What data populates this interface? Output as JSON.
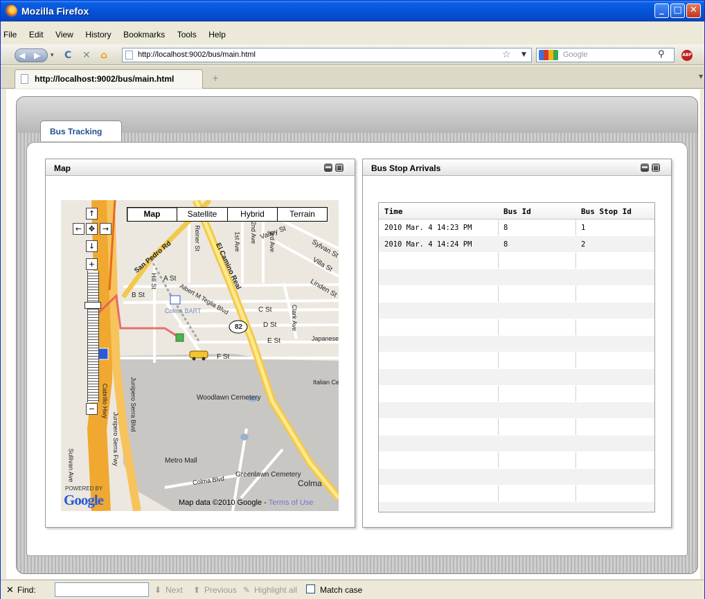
{
  "window": {
    "title": "Mozilla Firefox"
  },
  "menu": [
    "File",
    "Edit",
    "View",
    "History",
    "Bookmarks",
    "Tools",
    "Help"
  ],
  "nav": {
    "url": "http://localhost:9002/bus/main.html",
    "search_placeholder": "Google"
  },
  "browser_tab": {
    "label": "http://localhost:9002/bus/main.html"
  },
  "app": {
    "tab_label": "Bus Tracking",
    "map_panel_title": "Map",
    "arrivals_panel_title": "Bus Stop Arrivals"
  },
  "map": {
    "types": [
      "Map",
      "Satellite",
      "Hybrid",
      "Terrain"
    ],
    "active_type": "Map",
    "attribution": "Map data ©2010  Google - ",
    "terms_link": "Terms of Use",
    "powered_by": "POWERED BY",
    "logo": "Google",
    "labels": [
      {
        "text": "San Pedro Rd"
      },
      {
        "text": "El Camino Real"
      },
      {
        "text": "Reiner St"
      },
      {
        "text": "2nd Ave"
      },
      {
        "text": "1st Ave"
      },
      {
        "text": "3rd Ave"
      },
      {
        "text": "Valley St"
      },
      {
        "text": "Sylvan St"
      },
      {
        "text": "Villa St"
      },
      {
        "text": "Linden St"
      },
      {
        "text": "A St"
      },
      {
        "text": "B St"
      },
      {
        "text": "C St"
      },
      {
        "text": "D St"
      },
      {
        "text": "E St"
      },
      {
        "text": "F St"
      },
      {
        "text": "Hill St"
      },
      {
        "text": "Albert M Teglia Blvd"
      },
      {
        "text": "Colma BART"
      },
      {
        "text": "Clark Ave"
      },
      {
        "text": "Woodlawn Cemetery"
      },
      {
        "text": "Metro Mall"
      },
      {
        "text": "Greenlawn Cemetery"
      },
      {
        "text": "Colma"
      },
      {
        "text": "Colma Blvd"
      },
      {
        "text": "Junipero Serra Blvd"
      },
      {
        "text": "Cabrillo Hwy"
      },
      {
        "text": "Junipero Serra Fwy"
      },
      {
        "text": "Japanese Cemetery"
      },
      {
        "text": "Italian Cemetery"
      },
      {
        "text": "Sullivan Ave"
      },
      {
        "text": "82"
      }
    ]
  },
  "arrivals": {
    "columns": [
      "Time",
      "Bus Id",
      "Bus Stop Id"
    ],
    "rows": [
      [
        "2010 Mar. 4 14:23 PM",
        "8",
        "1"
      ],
      [
        "2010 Mar. 4 14:24 PM",
        "8",
        "2"
      ]
    ],
    "empty_row_count": 16
  },
  "findbar": {
    "label": "Find:",
    "value": "",
    "next": "Next",
    "previous": "Previous",
    "highlight_all": "Highlight all",
    "match_case": "Match case"
  },
  "colors": {
    "titlebar": "#0553d9",
    "tab_text": "#1f4e8f",
    "route": "#e8585a",
    "highway": "#f2b23a"
  }
}
